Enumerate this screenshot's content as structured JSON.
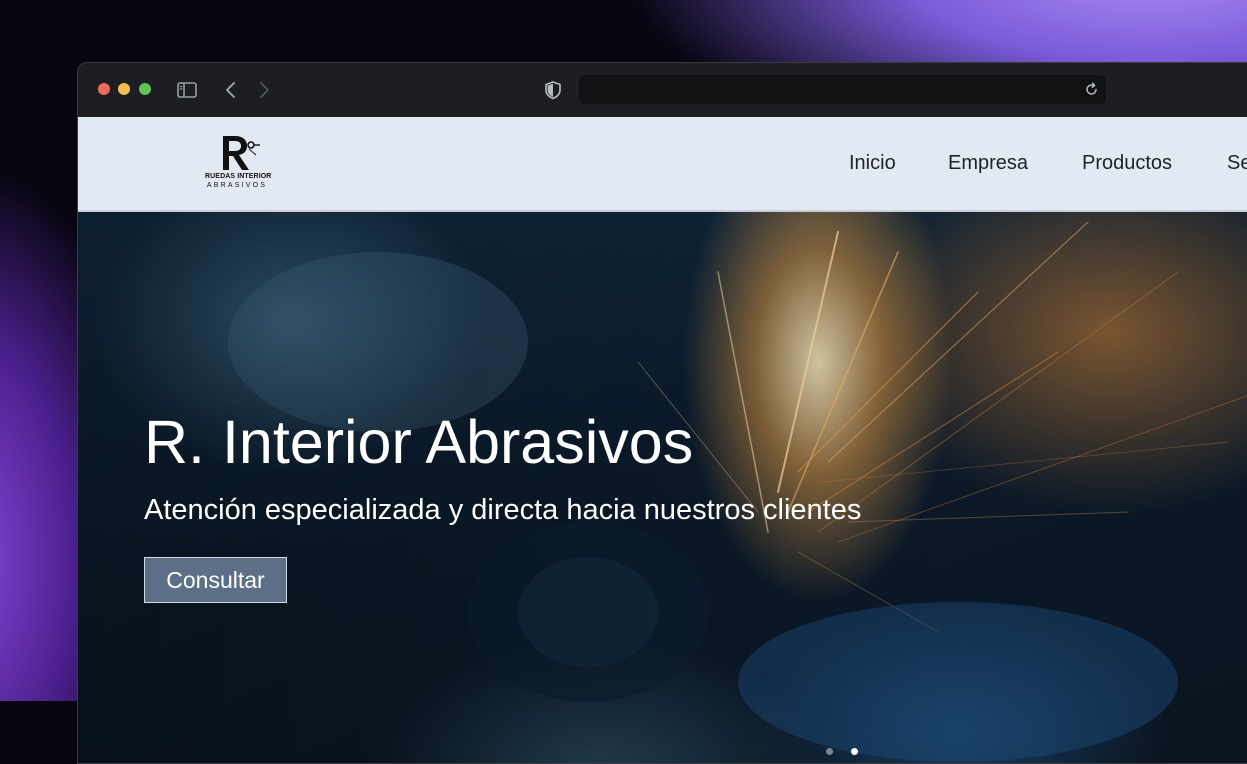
{
  "window": {
    "traffic_lights": {
      "close_color": "#ee6a5e",
      "minimize_color": "#f5bd4f",
      "maximize_color": "#61c454"
    },
    "toolbar_icons": [
      "sidebar-icon",
      "back-icon",
      "forward-icon",
      "shield-icon",
      "reload-icon"
    ]
  },
  "address_bar": {
    "value": ""
  },
  "site": {
    "logo": {
      "line1": "RUEDAS INTERIOR",
      "line2": "ABRASIVOS"
    },
    "nav": [
      {
        "label": "Inicio"
      },
      {
        "label": "Empresa"
      },
      {
        "label": "Productos"
      },
      {
        "label": "Se"
      }
    ]
  },
  "hero": {
    "title": "R. Interior Abrasivos",
    "subtitle": "Atención especializada y directa hacia nuestros clientes",
    "button_label": "Consultar",
    "carousel": {
      "slides": 2,
      "active_index": 2
    }
  },
  "colors": {
    "header_bg": "#e3e9f2",
    "button_bg": "#5d6f86",
    "chrome_bg": "#1c1e22"
  }
}
